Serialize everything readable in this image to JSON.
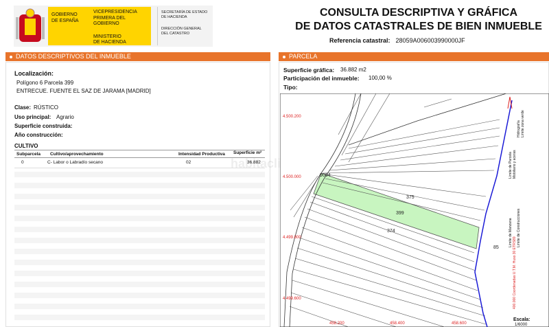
{
  "header": {
    "gob_line1": "GOBIERNO",
    "gob_line2": "DE ESPAÑA",
    "vice_line1": "VICEPRESIDENCIA",
    "vice_line2": "PRIMERA DEL GOBIERNO",
    "vice_line3": "MINISTERIO",
    "vice_line4": "DE HACIENDA",
    "sec_line1": "SECRETARÍA DE ESTADO",
    "sec_line2": "DE HACIENDA",
    "sec_line3": "DIRECCIÓN GENERAL",
    "sec_line4": "DEL CATASTRO",
    "title_line1": "CONSULTA DESCRIPTIVA Y GRÁFICA",
    "title_line2": "DE DATOS CATASTRALES DE BIEN INMUEBLE",
    "ref_label": "Referencia catastral:",
    "ref_value": "28059A006003990000JF"
  },
  "left": {
    "bar_title": "DATOS DESCRIPTIVOS DEL INMUEBLE",
    "localizacion_label": "Localización:",
    "localizacion_line1": "Polígono 6 Parcela 399",
    "localizacion_line2": "ENTRECUE. FUENTE EL SAZ DE JARAMA [MADRID]",
    "clase_label": "Clase:",
    "clase_value": "RÚSTICO",
    "uso_label": "Uso principal:",
    "uso_value": "Agrario",
    "sup_cons_label": "Superficie construida:",
    "anio_label": "Año construcción:",
    "cultivo_title": "CULTIVO",
    "table": {
      "headers": [
        "Subparcela",
        "Cultivo/aprovechamiento",
        "Intensidad Productiva",
        "Superficie m²"
      ],
      "rows": [
        [
          "0",
          "C- Labor o Labradío secano",
          "02",
          "36.882"
        ]
      ]
    }
  },
  "right": {
    "bar_title": "PARCELA",
    "sup_grafica_label": "Superficie gráfica:",
    "sup_grafica_value": "36.882 m2",
    "participacion_label": "Participación del inmueble:",
    "participacion_value": "100,00 %",
    "tipo_label": "Tipo:",
    "map": {
      "y_labels": [
        "4.500.200",
        "4.500.000",
        "4.499.800",
        "4.499.600"
      ],
      "x_labels": [
        "458.200",
        "458.400",
        "458.600"
      ],
      "parcel_labels": [
        "9004",
        "375",
        "399",
        "374",
        "85"
      ],
      "highlight_color": "#c8f5c0",
      "legend": [
        "Límite de Manzana",
        "Límite de Parcela",
        "Límite de Construcciones",
        "Mobiliario y aceras",
        "Límite zona verde",
        "Hidrografía"
      ],
      "crs_note": "400.000 Coordenadas U.T.M. Huso 30 ETRS89",
      "escala_label": "Escala:",
      "escala_value": "1/6000"
    }
  },
  "watermark": "habitaclia"
}
